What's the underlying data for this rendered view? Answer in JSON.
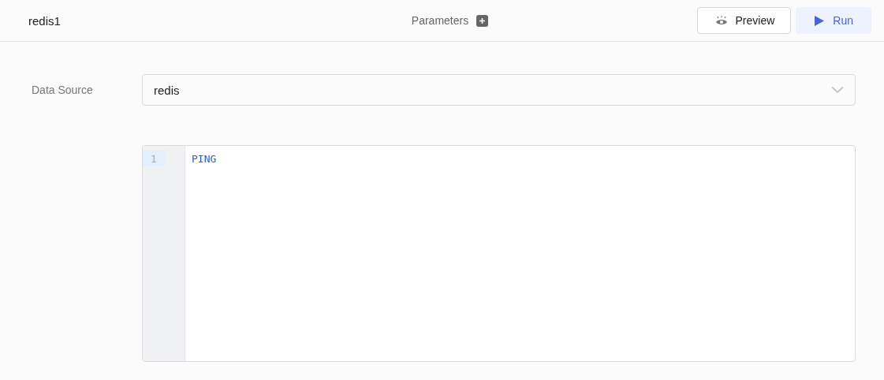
{
  "header": {
    "title": "redis1",
    "parameters_label": "Parameters",
    "buttons": [
      {
        "label": "Preview",
        "kind": "preview"
      },
      {
        "label": "Run",
        "kind": "run"
      }
    ]
  },
  "form": {
    "data_source": {
      "label": "Data Source",
      "value": "redis"
    }
  },
  "editor": {
    "lines": [
      {
        "number": "1",
        "text": "PING",
        "active": true
      }
    ]
  }
}
